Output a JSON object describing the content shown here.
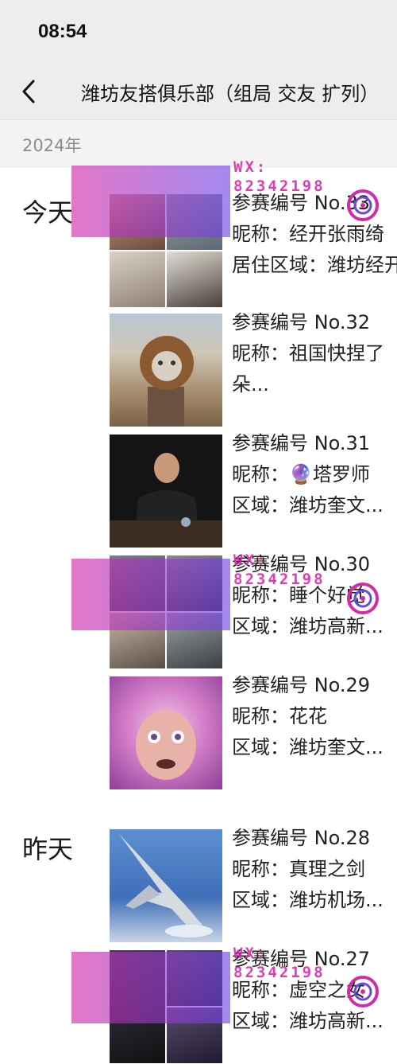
{
  "status_bar": {
    "time": "08:54"
  },
  "nav": {
    "title": "潍坊友搭俱乐部（组局 交友 扩列）"
  },
  "year_label": "2024年",
  "days": [
    {
      "label": "今天"
    },
    {
      "label": "昨天"
    }
  ],
  "posts": [
    {
      "lines": [
        "参赛编号 No.33",
        "昵称：经开张雨绮",
        "居住区域：潍坊经开"
      ]
    },
    {
      "lines": [
        "参赛编号 No.32",
        "昵称：祖国快捏了",
        "朵..."
      ]
    },
    {
      "lines": [
        "参赛编号 No.31",
        "昵称：🔮塔罗师",
        "区域：潍坊奎文..."
      ]
    },
    {
      "lines": [
        "参赛编号 No.30",
        "昵称：睡个好觉",
        "区域：潍坊高新..."
      ]
    },
    {
      "lines": [
        "参赛编号 No.29",
        "昵称：花花",
        "区域：潍坊奎文..."
      ]
    },
    {
      "lines": [
        "参赛编号 No.28",
        "昵称：真理之剑",
        "区域：潍坊机场..."
      ]
    },
    {
      "lines": [
        "参赛编号 No.27",
        "昵称：虚空之女",
        "区域：潍坊高新..."
      ]
    }
  ],
  "watermark": {
    "line1": "WX:",
    "line2": "82342198"
  },
  "colors": {
    "background": "#ffffff",
    "header": "#ededed",
    "watermark_pink": "#d22aa8",
    "watermark_purple": "#6e46e6"
  }
}
